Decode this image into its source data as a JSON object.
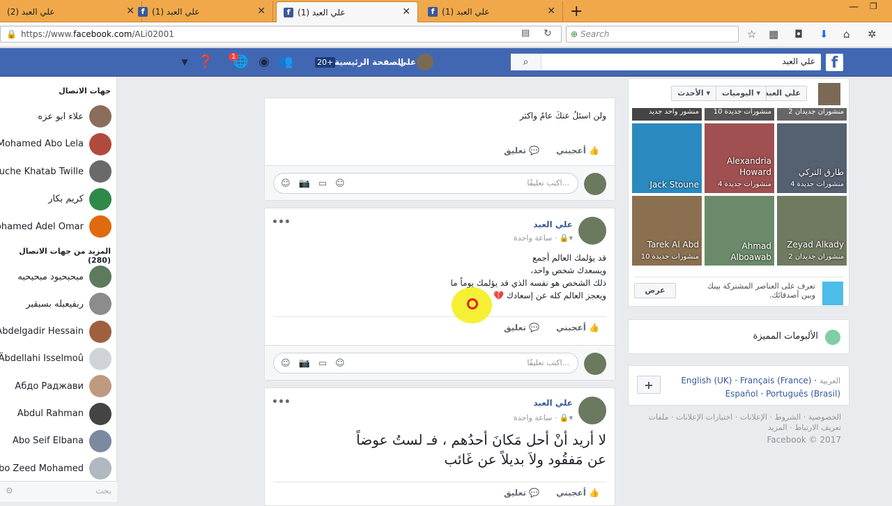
{
  "browser": {
    "tabs": [
      {
        "label": "علي العبد (2)",
        "close": "✕",
        "active": false
      },
      {
        "label": "علي العبد (1)",
        "close": "✕",
        "active": false
      },
      {
        "label": "علي العبد (1)",
        "close": "✕",
        "active": true
      },
      {
        "label": "علي العبد (1)",
        "close": "✕",
        "active": false
      }
    ],
    "new_tab": "+",
    "url_prefix": "https://www.",
    "url_domain": "facebook.com",
    "url_path": "/ALi02001",
    "search_placeholder": "Search"
  },
  "fb_header": {
    "search_value": "علي العبد",
    "home_label": "الصفحة الرئيسية",
    "home_badge": "20+",
    "user_name": "علي",
    "notif_count": "1"
  },
  "chat": {
    "contacts_heading": "جهات الاتصال",
    "more_heading": "المزيد من جهات الاتصال (280)",
    "search_placeholder": "بحث",
    "contacts": [
      {
        "name": "علاء ابو عزه",
        "color": "#8a6d5a"
      },
      {
        "name": "Mohamed Abo Lela",
        "color": "#b04a3c"
      },
      {
        "name": "Touche Khatab Twille",
        "color": "#6a6a6a"
      },
      {
        "name": "كريم بكار",
        "color": "#2f8a4a"
      },
      {
        "name": "Mohamed Adel Omar",
        "color": "#e06a10"
      }
    ],
    "more_contacts": [
      {
        "name": "مبحبحبود مبحبحبه",
        "color": "#5e7a5e"
      },
      {
        "name": "ربفيعبله بسبقبر",
        "color": "#8c8c8c"
      },
      {
        "name": "Abdelgadir Hessain",
        "color": "#a06040"
      },
      {
        "name": "Äbdellahi Isselmoû",
        "color": "#d0d4d8"
      },
      {
        "name": "Абдо Раджави",
        "color": "#c09a80"
      },
      {
        "name": "Abdul Rahman",
        "color": "#444"
      },
      {
        "name": "Abo Seif Elbana",
        "color": "#7a8aa0"
      },
      {
        "name": "Abo Zeed Mohamed",
        "color": "#b0b8c0"
      }
    ]
  },
  "feed": {
    "post0": {
      "text": "ولن اسئلُ عنكَ عامٌ واكثر",
      "like": "أعجبني",
      "comment": "تعليق",
      "comment_placeholder": "اكتب تعليقًا..."
    },
    "post1": {
      "author": "علي العبد",
      "meta": "ساعة واحدة ·",
      "lines": [
        "قد يؤلمك العالم أجمع",
        "ويسعدك شخص واحد،",
        "ذلك الشخص هو نفسه الذي قد يؤلمك يوماً ما",
        "ويعجز العالم كله عن إسعادك 💔"
      ],
      "like": "أعجبني",
      "comment": "تعليق",
      "comment_placeholder": "اكتب تعليقًا..."
    },
    "post2": {
      "author": "علي العبد",
      "meta": "ساعة واحدة ·",
      "line1": "لا أريد أنْ أحل مَكانَ أحدُهم ، فـ لستُ عوضاً",
      "line2": "عن مَفقُود ولاَ بديلاً عن غَائب",
      "like": "أعجبني",
      "comment": "تعليق"
    }
  },
  "right": {
    "filter": {
      "name": "علي العبد",
      "diaries": "اليوميات",
      "latest": "الأحدث"
    },
    "top_captions": [
      "منشور واحد جديد",
      "10 منشورات جديدة",
      "2 منشوران جديدان"
    ],
    "photos": [
      {
        "name": "Jack Stoune",
        "sub": "",
        "color": "#2a8ac0"
      },
      {
        "name": "Alexandria Howard",
        "sub": "4 منشورات جديدة",
        "color": "#a05050"
      },
      {
        "name": "طارق التركي",
        "sub": "4 منشورات جديدة",
        "color": "#556070"
      },
      {
        "name": "Tarek Al Abd",
        "sub": "10 منشورات جديدة",
        "color": "#8a7050"
      },
      {
        "name": "Ahmad Alboawab",
        "sub": "",
        "color": "#6a8a6a"
      },
      {
        "name": "Zeyad Alkady",
        "sub": "2 منشوران جديدان",
        "color": "#707a60"
      }
    ],
    "suggest_text": "تعرف على العناصر المشتركة بينك وبين أصدقائك.",
    "view_button": "عرض",
    "albums_title": "الألبومات المميزة",
    "lang_current": "العربية",
    "languages": [
      "English (UK)",
      "Français (France)",
      "Español",
      "Português (Brasil)"
    ],
    "add_button": "+",
    "footer_line1": "الخصوصية · الشروط · الإعلانات · اختيارات الإعلانات · ملفات",
    "footer_line2": "تعريف الارتباط · المزيد",
    "copyright": "Facebook © 2017"
  }
}
